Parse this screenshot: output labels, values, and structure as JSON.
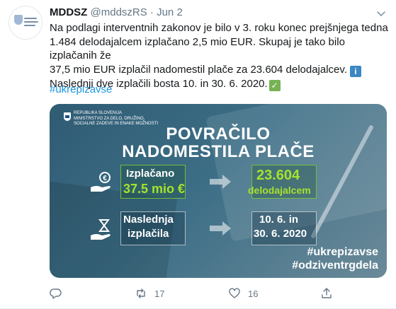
{
  "tweet": {
    "author_name": "MDDSZ",
    "handle": "@mddszRS",
    "separator": "·",
    "date": "Jun 2",
    "text_line1": "Na podlagi interventnih zakonov je bilo v 3. roku konec prejšnjega tedna",
    "text_line2": "1.484 delodajalcem izplačano 2,5 mio EUR. Skupaj je tako bilo izplačanih že",
    "text_line3": "37,5 mio EUR izplačil nadomestil plače za 23.604 delodajalcev.",
    "text_line4": "Naslednji dve izplačili bosta 10. in 30. 6. 2020.",
    "info_emoji": "i",
    "check_emoji": "✓",
    "hashtag": "#ukrepizavse"
  },
  "card": {
    "gov_line1": "REPUBLIKA SLOVENIJA",
    "gov_line2": "MINISTRSTVO ZA DELO, DRUŽINO,",
    "gov_line3": "SOCIALNE ZADEVE IN ENAKE MOŽNOSTI",
    "title_line1": "POVRAČILO",
    "title_line2": "NADOMESTILA PLAČE",
    "paid_label": "Izplačano",
    "paid_amount": "37.5 mio €",
    "employers_count": "23.604",
    "employers_label": "delodajalcem",
    "next_label_1": "Naslednja",
    "next_label_2": "izplačila",
    "dates_1": "10. 6. in",
    "dates_2": "30. 6. 2020",
    "tag1": "#ukrepizavse",
    "tag2": "#odziventrgdela"
  },
  "actions": {
    "reply_count": "",
    "retweet_count": "17",
    "like_count": "16"
  },
  "colors": {
    "accent": "#1b95e0",
    "highlight_green": "#a6e22e",
    "muted": "#657786"
  }
}
